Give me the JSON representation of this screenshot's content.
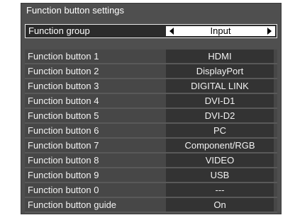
{
  "title": "Function button settings",
  "function_group": {
    "label": "Function group",
    "value": "Input"
  },
  "buttons": [
    {
      "label": "Function button 1",
      "value": "HDMI"
    },
    {
      "label": "Function button 2",
      "value": "DisplayPort"
    },
    {
      "label": "Function button 3",
      "value": "DIGITAL LINK"
    },
    {
      "label": "Function button 4",
      "value": "DVI-D1"
    },
    {
      "label": "Function button 5",
      "value": "DVI-D2"
    },
    {
      "label": "Function button 6",
      "value": "PC"
    },
    {
      "label": "Function button 7",
      "value": "Component/RGB"
    },
    {
      "label": "Function button 8",
      "value": "VIDEO"
    },
    {
      "label": "Function button 9",
      "value": "USB"
    },
    {
      "label": "Function button 0",
      "value": "---"
    },
    {
      "label": "Function button guide",
      "value": "On"
    }
  ]
}
